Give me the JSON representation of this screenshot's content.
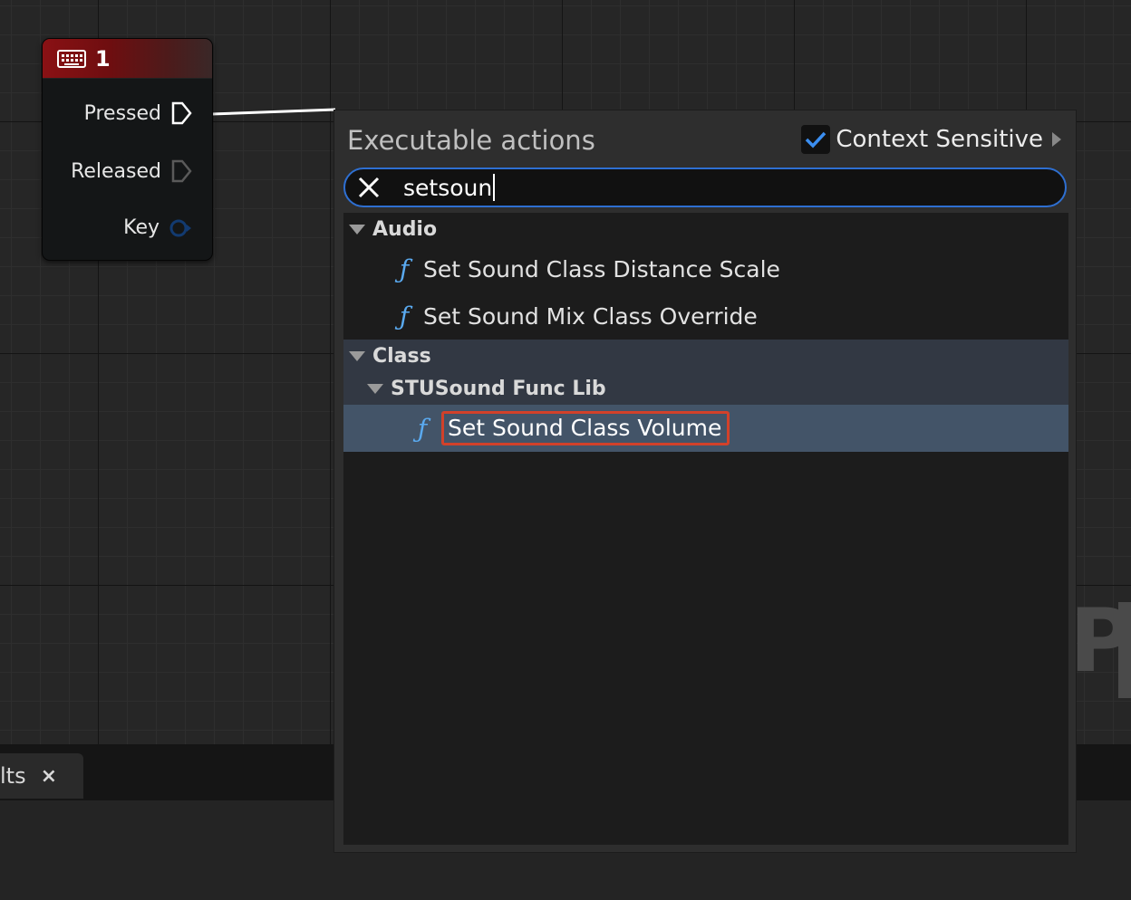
{
  "graph": {
    "node": {
      "title": "1",
      "icon": "keyboard-icon",
      "header_color": "#8a1114",
      "pins": [
        {
          "label": "Pressed",
          "type": "exec-output"
        },
        {
          "label": "Released",
          "type": "exec-output"
        },
        {
          "label": "Key",
          "type": "key-output"
        }
      ]
    },
    "watermark_text": "P"
  },
  "bottom_panel": {
    "tab_label": "lts",
    "tab_close": "×"
  },
  "action_menu": {
    "title": "Executable actions",
    "context_sensitive": {
      "label": "Context Sensitive",
      "checked": true
    },
    "search": {
      "value": "setsoun",
      "clear_icon": "close-icon"
    },
    "accent_color": "#2e6fd1",
    "highlight_color": "#d2412a",
    "categories": [
      {
        "name": "Audio",
        "items": [
          "Set Sound Class Distance Scale",
          "Set Sound Mix Class Override"
        ]
      },
      {
        "name": "Class",
        "subcategories": [
          {
            "name": "STUSound Func Lib",
            "items": [
              "Set Sound Class Volume"
            ]
          }
        ]
      }
    ],
    "selected_item": "Set Sound Class Volume"
  }
}
